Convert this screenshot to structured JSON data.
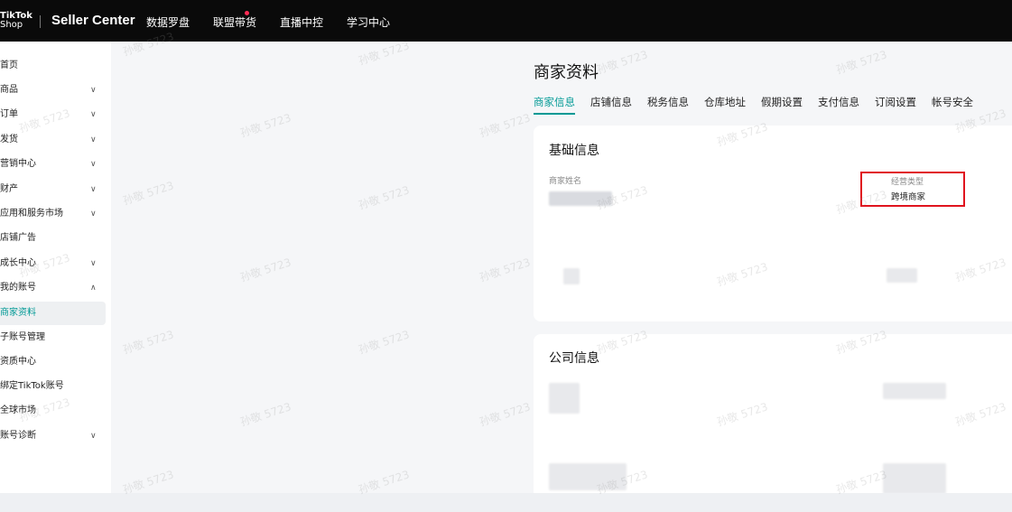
{
  "topbar": {
    "logo_line1": "TikTok",
    "logo_line2": "Shop",
    "title": "Seller Center",
    "nav": [
      "数据罗盘",
      "联盟带货",
      "直播中控",
      "学习中心"
    ]
  },
  "sidebar": {
    "items": [
      {
        "label": "首页",
        "chevron": ""
      },
      {
        "label": "商品",
        "chevron": "∨"
      },
      {
        "label": "订单",
        "chevron": "∨"
      },
      {
        "label": "发货",
        "chevron": "∨"
      },
      {
        "label": "营销中心",
        "chevron": "∨"
      },
      {
        "label": "财产",
        "chevron": "∨"
      },
      {
        "label": "应用和服务市场",
        "chevron": "∨"
      },
      {
        "label": "店铺广告",
        "chevron": ""
      },
      {
        "label": "成长中心",
        "chevron": "∨"
      },
      {
        "label": "我的账号",
        "chevron": "∧"
      },
      {
        "label": "商家资料",
        "chevron": "",
        "active": true
      },
      {
        "label": "子账号管理",
        "chevron": ""
      },
      {
        "label": "资质中心",
        "chevron": ""
      },
      {
        "label": "绑定TikTok账号",
        "chevron": ""
      },
      {
        "label": "全球市场",
        "chevron": ""
      },
      {
        "label": "账号诊断",
        "chevron": "∨"
      }
    ]
  },
  "main": {
    "title": "商家资料",
    "tabs": [
      "商家信息",
      "店铺信息",
      "税务信息",
      "仓库地址",
      "假期设置",
      "支付信息",
      "订阅设置",
      "帐号安全"
    ],
    "basic_info": {
      "title": "基础信息",
      "merchant_name_label": "商家姓名",
      "business_type_label": "经营类型",
      "business_type_value": "跨境商家"
    },
    "company_info": {
      "title": "公司信息"
    }
  },
  "watermark": "孙敬 5723",
  "colors": {
    "accent": "#009995",
    "highlight": "#e0141e",
    "topbar": "#0a0a0a"
  }
}
